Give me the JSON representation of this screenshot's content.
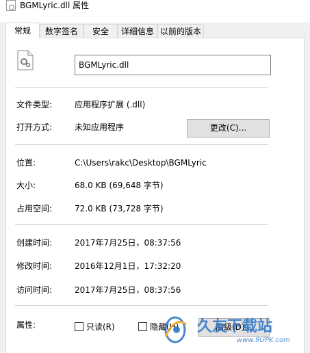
{
  "window": {
    "title": "BGMLyric.dll 属性"
  },
  "tabs": [
    {
      "label": "常规"
    },
    {
      "label": "数字签名"
    },
    {
      "label": "安全"
    },
    {
      "label": "详细信息"
    },
    {
      "label": "以前的版本"
    }
  ],
  "general": {
    "filename": "BGMLyric.dll",
    "file_type_label": "文件类型:",
    "file_type_value": "应用程序扩展 (.dll)",
    "open_with_label": "打开方式:",
    "open_with_value": "未知应用程序",
    "change_button": "更改(C)...",
    "location_label": "位置:",
    "location_value": "C:\\Users\\rakc\\Desktop\\BGMLyric",
    "size_label": "大小:",
    "size_value": "68.0 KB (69,648 字节)",
    "size_on_disk_label": "占用空间:",
    "size_on_disk_value": "72.0 KB (73,728 字节)",
    "created_label": "创建时间:",
    "created_value": "2017年7月25日，08:37:56",
    "modified_label": "修改时间:",
    "modified_value": "2016年12月1日，17:32:20",
    "accessed_label": "访问时间:",
    "accessed_value": "2017年7月25日，08:37:56",
    "attributes_label": "属性:",
    "readonly_label": "只读(R)",
    "hidden_label": "隐藏(H)",
    "advanced_button": "高级(D)..."
  },
  "watermark": {
    "brand": "久友下载站",
    "url": "www.9UPK.com"
  },
  "colors": {
    "panel_bg": "#ffffff",
    "window_bg": "#f0f0f0",
    "button_bg": "#e1e1e1",
    "watermark_blue": "#2a73c9",
    "watermark_orange": "#f0a020"
  }
}
